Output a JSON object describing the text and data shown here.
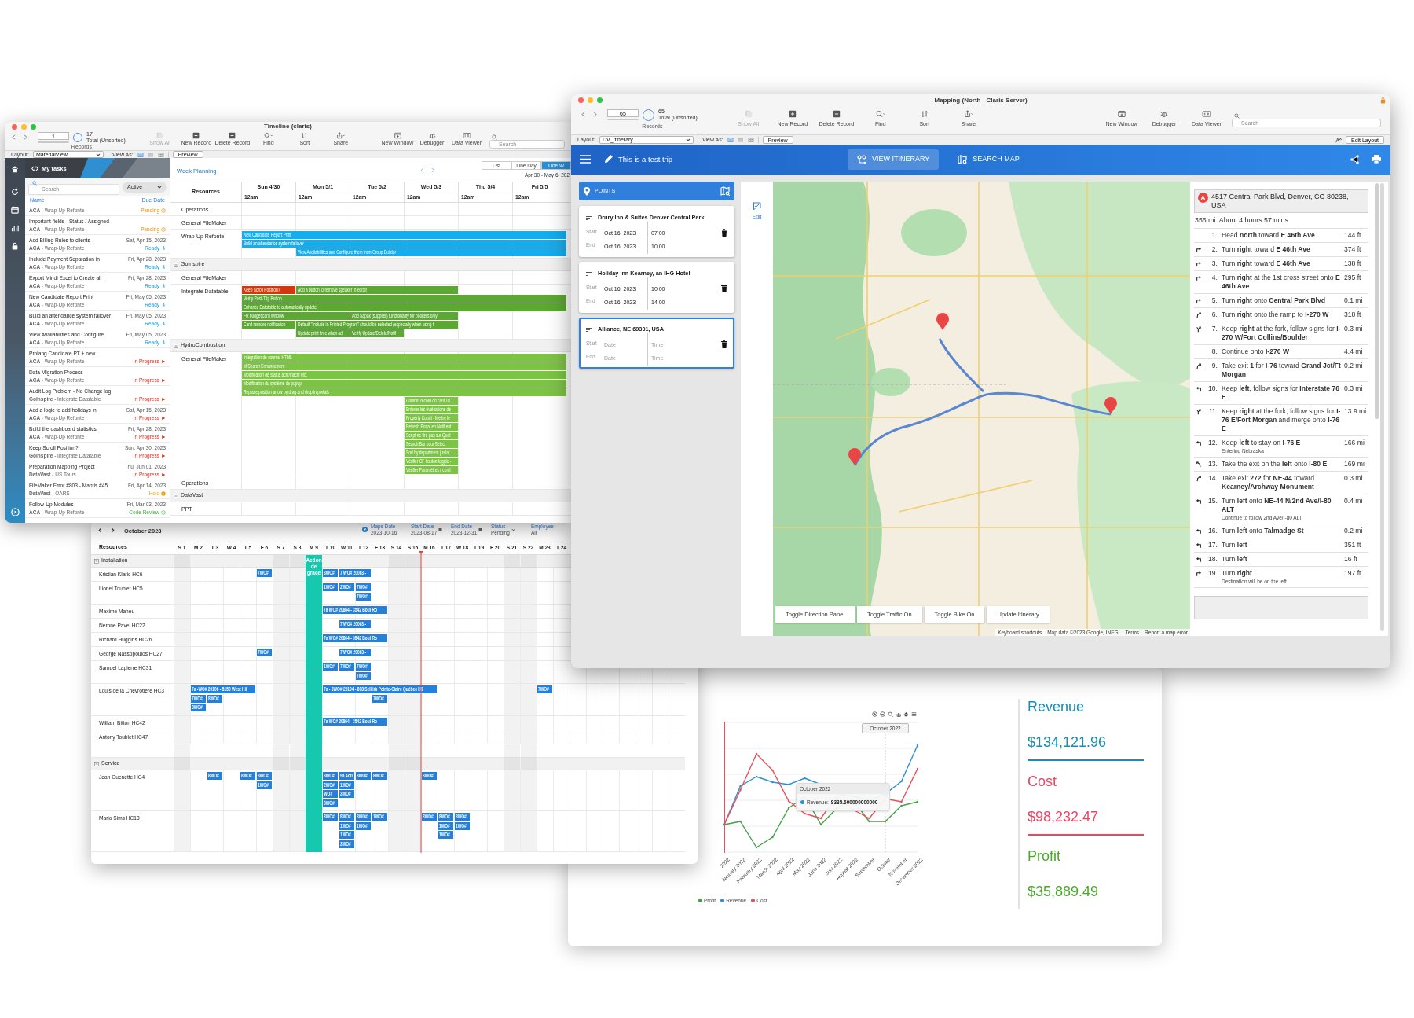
{
  "timeline_window": {
    "title": "Timeline (claris)",
    "toolbar": {
      "record": "1",
      "found": "17",
      "found_note": "Total (Unsorted)",
      "records_label": "Records",
      "buttons": [
        {
          "label": "Show All",
          "disabled": true
        },
        {
          "label": "New Record",
          "disabled": false
        },
        {
          "label": "Delete Record",
          "disabled": false
        },
        {
          "label": "Find",
          "disabled": false
        },
        {
          "label": "Sort",
          "disabled": false
        },
        {
          "label": "Share",
          "disabled": false
        }
      ],
      "right_buttons": [
        "New Window",
        "Debugger",
        "Data Viewer"
      ],
      "search_placeholder": "Search"
    },
    "layout_bar": {
      "layout_label": "Layout:",
      "layout": "MaterialView",
      "view_as_label": "View As:",
      "view_modes": [
        {
          "selected": true
        },
        {
          "selected": false
        },
        {
          "selected": false
        }
      ],
      "preview": "Preview"
    },
    "tasks": {
      "title": "My tasks",
      "search_placeholder": "Search",
      "filter": "Active",
      "columns": [
        "Name",
        "Due Date"
      ],
      "items": [
        {
          "project": "**ACA** - Wrap-Up Refonte",
          "status": "Pending",
          "kind": "pending"
        },
        {
          "title": "Important fields - Status / Assigned",
          "project": "**ACA** - Wrap-Up Refonte",
          "status": "Pending",
          "kind": "pending"
        },
        {
          "title": "Add Billing Rules to clients",
          "due": "Sat, Apr 15, 2023",
          "project": "**ACA** - Wrap-Up Refonte",
          "status": "Ready",
          "kind": "ready"
        },
        {
          "title": "Include Payment Separation in",
          "due": "Fri, Apr 28, 2023",
          "project": "**ACA** - Wrap-Up Refonte",
          "status": "Ready",
          "kind": "ready"
        },
        {
          "title": "Export Mindi Excel to Create all",
          "due": "Fri, Apr 28, 2023",
          "project": "**ACA** - Wrap-Up Refonte",
          "status": "Ready",
          "kind": "ready"
        },
        {
          "title": "New Candidate Report Print",
          "due": "Fri, May 05, 2023",
          "project": "**ACA** - Wrap-Up Refonte",
          "status": "Ready",
          "kind": "ready"
        },
        {
          "title": "Build an attendance system failover",
          "due": "Fri, May 05, 2023",
          "project": "**ACA** - Wrap-Up Refonte",
          "status": "Ready",
          "kind": "ready"
        },
        {
          "title": "View Availabilities and Configure",
          "due": "Fri, May 05, 2023",
          "project": "**ACA** - Wrap-Up Refonte",
          "status": "Ready",
          "kind": "ready"
        },
        {
          "title": "Prolang Candidate PT + new",
          "project": "**ACA** - Wrap-Up Refonte",
          "status": "In Progress",
          "kind": "progress"
        },
        {
          "title": "Data Migration Process",
          "project": "**ACA** - Wrap-Up Refonte",
          "status": "In Progress",
          "kind": "progress"
        },
        {
          "title": "Audit Log Problem - No Change log",
          "project": "**GoInspire** - Integrate Datatable",
          "status": "In Progress",
          "kind": "progress"
        },
        {
          "title": "Add a logic to add holidays in",
          "due": "Sat, Apr 15, 2023",
          "project": "**ACA** - Wrap-Up Refonte",
          "status": "In Progress",
          "kind": "progress"
        },
        {
          "title": "Build the dashboard statistics",
          "due": "Fri, Apr 28, 2023",
          "project": "**ACA** - Wrap-Up Refonte",
          "status": "In Progress",
          "kind": "progress"
        },
        {
          "title": "Keep Scroll Position?",
          "due": "Sun, Apr 30, 2023",
          "project": "**GoInspire** - Integrate Datatable",
          "status": "In Progress",
          "kind": "progress"
        },
        {
          "title": "Preparation Mapping Project",
          "due": "Thu, Jun 01, 2023",
          "project": "**DataVast** - US Tours",
          "status": "In Progress",
          "kind": "progress"
        },
        {
          "title": "FileMaker Error #803 - Mantis #45",
          "due": "Fri, Apr 14, 2023",
          "project": "**DataVast** - OARS",
          "status": "Hold",
          "kind": "hold"
        },
        {
          "title": "Follow-Up Modules",
          "due": "Fri, Mar 03, 2023",
          "project": "**ACA** - Wrap-Up Refonte",
          "status": "Code Review",
          "kind": "review"
        }
      ]
    },
    "planner": {
      "title": "Week Planning",
      "views": [
        {
          "label": "List",
          "selected": false
        },
        {
          "label": "Line Day",
          "selected": false
        },
        {
          "label": "Line W",
          "selected": true
        }
      ],
      "range": "Apr 30 - May 6, 202",
      "resources_label": "Resources",
      "days": [
        {
          "day": "Sun 4/30",
          "time": "12am"
        },
        {
          "day": "Mon 5/1",
          "time": "12am"
        },
        {
          "day": "Tue 5/2",
          "time": "12am"
        },
        {
          "day": "Wed 5/3",
          "time": "12am"
        },
        {
          "day": "Thu 5/4",
          "time": "12am"
        },
        {
          "day": "Fri 5/5",
          "time": "12am"
        }
      ],
      "rows": [
        {
          "kind": "resource",
          "label": "Operations"
        },
        {
          "kind": "resource",
          "label": "General FileMaker"
        },
        {
          "kind": "resource",
          "label": "Wrap-Up Refonte",
          "bars": [
            {
              "label": "New Candidate Report Print",
              "color": "#14adee"
            },
            {
              "label": "Build an attendance system failover",
              "color": "#14adee"
            },
            {
              "label": "View Availabilities and Configure them from Group Builder",
              "color": "#14adee"
            }
          ]
        },
        {
          "kind": "group",
          "label": "GoInspire",
          "expanded": true
        },
        {
          "kind": "resource",
          "label": "General FileMaker"
        },
        {
          "kind": "resource",
          "label": "Integrate Datatable",
          "bars": [
            {
              "label": "Keep Scroll Position?",
              "color": "#d1380d"
            },
            {
              "label": "Add a button to remove speaker in editor",
              "color": "#5ba832"
            },
            {
              "label": "Verify Post-Trip Button",
              "color": "#5ba832"
            },
            {
              "label": "Enhance Datatable to automatically update",
              "color": "#5ba832"
            },
            {
              "label": "Fix budget card window",
              "color": "#5ba832"
            },
            {
              "label": "Add Sapak (supplier) functionality for bookers only",
              "color": "#5ba832"
            },
            {
              "label": "Can't remove notification",
              "color": "#5ba832"
            },
            {
              "label": "Default \"Include in Printed Program\" should be selected (especially when using t",
              "color": "#5ba832"
            },
            {
              "label": "Update print time when ad",
              "color": "#5ba832"
            },
            {
              "label": "Verify Update/Delete/Notif",
              "color": "#5ba832"
            }
          ]
        },
        {
          "kind": "group",
          "label": "HydroCombustion",
          "expanded": true
        },
        {
          "kind": "resource",
          "label": "General FileMaker",
          "bars": [
            {
              "label": "Intégration de courriel HTML",
              "color": "#7cc444"
            },
            {
              "label": "M.Search Enhancement",
              "color": "#7cc444"
            },
            {
              "label": "Modification de status actif/inactif etc.",
              "color": "#7cc444"
            },
            {
              "label": "Modification du système de popup",
              "color": "#7cc444"
            },
            {
              "label": "Replace position arrow by drag and drop in portals",
              "color": "#7cc444"
            },
            {
              "label": "Commit record on card us",
              "color": "#7cc444"
            },
            {
              "label": "Enlever les évaluations de",
              "color": "#7cc444"
            },
            {
              "label": "Property Count - Mettre le",
              "color": "#7cc444"
            },
            {
              "label": "Refresh Portal en Notif ent",
              "color": "#7cc444"
            },
            {
              "label": "Script ne fire pas sur Quot",
              "color": "#7cc444"
            },
            {
              "label": "Search Bar pour Select",
              "color": "#7cc444"
            },
            {
              "label": "Sort by department ( relat",
              "color": "#7cc444"
            },
            {
              "label": "Vérifier CF bouton toggle -",
              "color": "#7cc444"
            },
            {
              "label": "Vérifier Paramètres ( conti",
              "color": "#7cc444"
            }
          ]
        },
        {
          "kind": "resource",
          "label": "Operations"
        },
        {
          "kind": "group",
          "label": "DataVast",
          "expanded": true
        },
        {
          "kind": "resource",
          "label": "PPT"
        }
      ]
    }
  },
  "scheduler_window": {
    "month": "October 2023",
    "filters": [
      {
        "label": "Maps Date",
        "value": "2023-10-16",
        "kind": "plain"
      },
      {
        "label": "Start Date",
        "value": "2023-08-17",
        "kind": "date"
      },
      {
        "label": "End Date",
        "value": "2023-12-31",
        "kind": "date"
      },
      {
        "label": "Status",
        "value": "Pending",
        "kind": "select"
      },
      {
        "label": "Employee",
        "value": "All",
        "kind": "plain"
      }
    ],
    "resources_label": "Resources",
    "days": [
      {
        "label": "S 1",
        "weekend": true
      },
      {
        "label": "M 2",
        "weekend": false
      },
      {
        "label": "T 3",
        "weekend": false
      },
      {
        "label": "W 4",
        "weekend": false
      },
      {
        "label": "T 5",
        "weekend": false
      },
      {
        "label": "F 6",
        "weekend": false
      },
      {
        "label": "S 7",
        "weekend": true
      },
      {
        "label": "S 8",
        "weekend": true
      },
      {
        "label": "M 9",
        "weekend": false
      },
      {
        "label": "T 10",
        "weekend": false
      },
      {
        "label": "W 11",
        "weekend": false
      },
      {
        "label": "T 12",
        "weekend": false
      },
      {
        "label": "F 13",
        "weekend": false
      },
      {
        "label": "S 14",
        "weekend": true
      },
      {
        "label": "S 15",
        "weekend": true
      },
      {
        "label": "M 16",
        "weekend": false
      },
      {
        "label": "T 17",
        "weekend": false
      },
      {
        "label": "W 18",
        "weekend": false
      },
      {
        "label": "T 19",
        "weekend": false
      },
      {
        "label": "F 20",
        "weekend": false
      },
      {
        "label": "S 21",
        "weekend": true
      },
      {
        "label": "S 22",
        "weekend": true
      },
      {
        "label": "M 23",
        "weekend": false
      },
      {
        "label": "T 24",
        "weekend": false
      }
    ],
    "holiday": "Action de grâce",
    "rows": [
      {
        "kind": "group",
        "label": "Installation",
        "expanded": true
      },
      {
        "kind": "resource",
        "label": "Kristian Klaric HC6",
        "events": [
          "7WO#",
          "8WO#",
          "7.WO# 20063 -"
        ]
      },
      {
        "kind": "resource",
        "label": "Lionel Toublet HC5",
        "events": [
          "1WO#",
          "2WO#",
          "7WO#",
          "7WO#"
        ]
      },
      {
        "kind": "resource",
        "label": "Maxime Maheu",
        "events": [
          "7a WO# 20864 - 3542 Boul Ro"
        ]
      },
      {
        "kind": "resource",
        "label": "Nerone Pavel HC22",
        "events": [
          "7.WO# 20063 -"
        ]
      },
      {
        "kind": "resource",
        "label": "Richard Huggins HC26",
        "events": [
          "7a WO# 20864 - 3542 Boul Ro"
        ]
      },
      {
        "kind": "resource",
        "label": "George Nassopoulos HC27",
        "events": [
          "7WO#",
          "7.WO# 20063 -"
        ]
      },
      {
        "kind": "resource",
        "label": "Samuel Lapierre HC31",
        "events": [
          "1WO#",
          "7WO#",
          "7WO#",
          "7WO#"
        ]
      },
      {
        "kind": "resource",
        "label": "Louis de la Chevrotière HC3",
        "events": [
          "7a -WO# 20106 - 5150 West Hil",
          "7a - 8WO# 20194 - 808 Selkirk Pointe-Claire Québec H9",
          "7WO#",
          "7WO#",
          "8WO#",
          "7WO#",
          "8WO#"
        ]
      },
      {
        "kind": "resource",
        "label": "William Bitton HC42",
        "events": [
          "7a WO# 20864 - 3542 Boul Ro"
        ]
      },
      {
        "kind": "resource",
        "label": "Antony Toublet HC47"
      },
      {
        "kind": "group",
        "label": "Service",
        "expanded": true
      },
      {
        "kind": "resource",
        "label": "Jean Guenette HC4",
        "events": [
          "8WO#",
          "8WO#",
          "8WO#",
          "1WO#",
          "8WO#",
          "9a Acti",
          "8WO#",
          "8WO#",
          "8WO#",
          "2WO#",
          "1WO#",
          "WO#",
          "3WO#",
          "8WO#"
        ]
      },
      {
        "kind": "resource",
        "label": "Mario Sims HC18",
        "events": [
          "8WO#",
          "8WO#",
          "8WO#",
          "1WO#",
          "8WO#",
          "8WO#",
          "8WO#",
          "1WO#",
          "1WO#",
          "1WO#",
          "1WO#",
          "1WO#",
          "1WO#",
          "3WO#"
        ]
      }
    ]
  },
  "dashboard_window": {
    "chart": {
      "x_labels": [
        "2022",
        "January 2022",
        "February 2022",
        "March 2022",
        "April 2022",
        "May 2022",
        "June 2022",
        "July 2022",
        "August 2022",
        "September",
        "Octobe",
        "November",
        "December 2022"
      ],
      "tooltip": {
        "title": "October 2022",
        "label": "Revenue:",
        "value": "8335.600000000000"
      },
      "crosshair_label": "October 2022",
      "legend": [
        {
          "name": "Profit",
          "color": "#43a047"
        },
        {
          "name": "Revenue",
          "color": "#2d8fd5"
        },
        {
          "name": "Cost",
          "color": "#e8505b"
        }
      ]
    },
    "kpis": [
      {
        "label": "Revenue",
        "value": "$134,121.96",
        "color": "#1a8db5"
      },
      {
        "label": "Cost",
        "value": "$98,232.47",
        "color": "#ee4466"
      },
      {
        "label": "Profit",
        "value": "$35,889.49",
        "color": "#4aa82a"
      }
    ]
  },
  "mapping_window": {
    "title": "Mapping (North - Claris Server)",
    "toolbar": {
      "record": "65",
      "found": "65",
      "found_note": "Total (Unsorted)",
      "records_label": "Records",
      "buttons": [
        {
          "label": "Show All",
          "disabled": true
        },
        {
          "label": "New Record",
          "disabled": false
        },
        {
          "label": "Delete Record",
          "disabled": false
        },
        {
          "label": "Find",
          "disabled": false
        },
        {
          "label": "Sort",
          "disabled": false
        },
        {
          "label": "Share",
          "disabled": false
        }
      ],
      "right_buttons": [
        "New Window",
        "Debugger",
        "Data Viewer"
      ],
      "search_placeholder": "Search"
    },
    "layout_bar": {
      "layout_label": "Layout:",
      "layout": "DV_Itinerary",
      "view_as_label": "View As:",
      "view_modes": [
        {
          "selected": true
        },
        {
          "selected": false
        },
        {
          "selected": false
        }
      ],
      "preview": "Preview",
      "edit_layout": "Edit Layout"
    },
    "header": {
      "trip": "This is a test trip",
      "tabs": [
        {
          "label": "VIEW ITINERARY",
          "selected": true
        },
        {
          "label": "SEARCH MAP",
          "selected": false
        }
      ]
    },
    "points": {
      "title": "POINTS",
      "items": [
        {
          "name": "Drury Inn & Suites Denver Central Park",
          "start_label": "Start",
          "end_label": "End",
          "start_date": {
            "value": "Oct 16, 2023"
          },
          "start_time": {
            "value": "07:00"
          },
          "end_date": {
            "value": "Oct 16, 2023"
          },
          "end_time": {
            "value": "10:00"
          },
          "selected": false
        },
        {
          "name": "Holiday Inn Kearney, an IHG Hotel",
          "start_label": "Start",
          "end_label": "End",
          "start_date": {
            "value": "Oct 16, 2023"
          },
          "start_time": {
            "value": "10:00"
          },
          "end_date": {
            "value": "Oct 16, 2023"
          },
          "end_time": {
            "value": "14:00"
          },
          "selected": false
        },
        {
          "name": "Alliance, NE 69301, USA",
          "start_label": "Start",
          "end_label": "End",
          "start_date": {
            "placeholder": "Date"
          },
          "start_time": {
            "placeholder": "Time"
          },
          "end_date": {
            "placeholder": "Date"
          },
          "end_time": {
            "placeholder": "Time"
          },
          "selected": true
        }
      ]
    },
    "edit_label": "Edit",
    "map": {
      "kind": "picture",
      "buttons": [
        "Toggle Direction Panel",
        "Toggle Traffic On",
        "Toggle Bike On",
        "Update Itinerary"
      ],
      "attribution": [
        "Keyboard shortcuts",
        "Map data ©2023 Google, INEGI",
        "Terms",
        "Report a map error"
      ]
    },
    "directions": {
      "origin_marker": "A",
      "origin": "4517 Central Park Blvd, Denver, CO 80238, USA",
      "summary": "356 mi. About 4 hours 57 mins",
      "steps": [
        {
          "number": "1.",
          "text": "Head **north** toward **E 46th Ave**",
          "distance": "144 ft",
          "kind": "straight"
        },
        {
          "number": "2.",
          "text": "Turn **right** toward **E 46th Ave**",
          "distance": "374 ft",
          "kind": "right"
        },
        {
          "number": "3.",
          "text": "Turn **right** toward **E 46th Ave**",
          "distance": "138 ft",
          "kind": "right"
        },
        {
          "number": "4.",
          "text": "Turn **right** at the 1st cross street onto **E 46th Ave**",
          "distance": "295 ft",
          "kind": "right"
        },
        {
          "number": "5.",
          "text": "Turn **right** onto **Central Park Blvd**",
          "distance": "0.1 mi",
          "kind": "right"
        },
        {
          "number": "6.",
          "text": "Turn **right** onto the ramp to **I-270 W**",
          "distance": "318 ft",
          "kind": "ramp_right"
        },
        {
          "number": "7.",
          "text": "Keep **right** at the fork, follow signs for **I-270 W/Fort Collins/Boulder**",
          "distance": "0.3 mi",
          "kind": "fork_right"
        },
        {
          "number": "8.",
          "text": "Continue onto **I-270 W**",
          "distance": "4.4 mi",
          "kind": "straight"
        },
        {
          "number": "9.",
          "text": "Take exit **1** for **I-76** toward **Grand Jct/Ft Morgan**",
          "distance": "0.2 mi",
          "kind": "ramp_right"
        },
        {
          "number": "10.",
          "text": "Keep **left**, follow signs for **Interstate 76 E**",
          "distance": "0.3 mi",
          "kind": "left"
        },
        {
          "number": "11.",
          "text": "Keep **right** at the fork, follow signs for **I-76 E/Fort Morgan** and merge onto **I-76 E**",
          "distance": "13.9 mi",
          "kind": "fork_right"
        },
        {
          "number": "12.",
          "text": "Keep **left** to stay on **I-76 E**",
          "note": "Entering Nebraska",
          "distance": "166 mi",
          "kind": "left"
        },
        {
          "number": "13.",
          "text": "Take the exit on the **left** onto **I-80 E**",
          "distance": "169 mi",
          "kind": "ramp_left"
        },
        {
          "number": "14.",
          "text": "Take exit **272** for **NE-44** toward **Kearney/Archway Monument**",
          "distance": "0.3 mi",
          "kind": "ramp_right"
        },
        {
          "number": "15.",
          "text": "Turn **left** onto **NE-44 N/2nd Ave/I-80 ALT**",
          "note": "Continue to follow 2nd Ave/I-80 ALT",
          "distance": "0.4 mi",
          "kind": "left"
        },
        {
          "number": "16.",
          "text": "Turn **left** onto **Talmadge St**",
          "distance": "0.2 mi",
          "kind": "left"
        },
        {
          "number": "17.",
          "text": "Turn **left**",
          "distance": "351 ft",
          "kind": "left"
        },
        {
          "number": "18.",
          "text": "Turn **left**",
          "distance": "16 ft",
          "kind": "left"
        },
        {
          "number": "19.",
          "text": "Turn **right**",
          "note": "Destination will be on the left",
          "distance": "197 ft",
          "kind": "right"
        }
      ]
    }
  }
}
